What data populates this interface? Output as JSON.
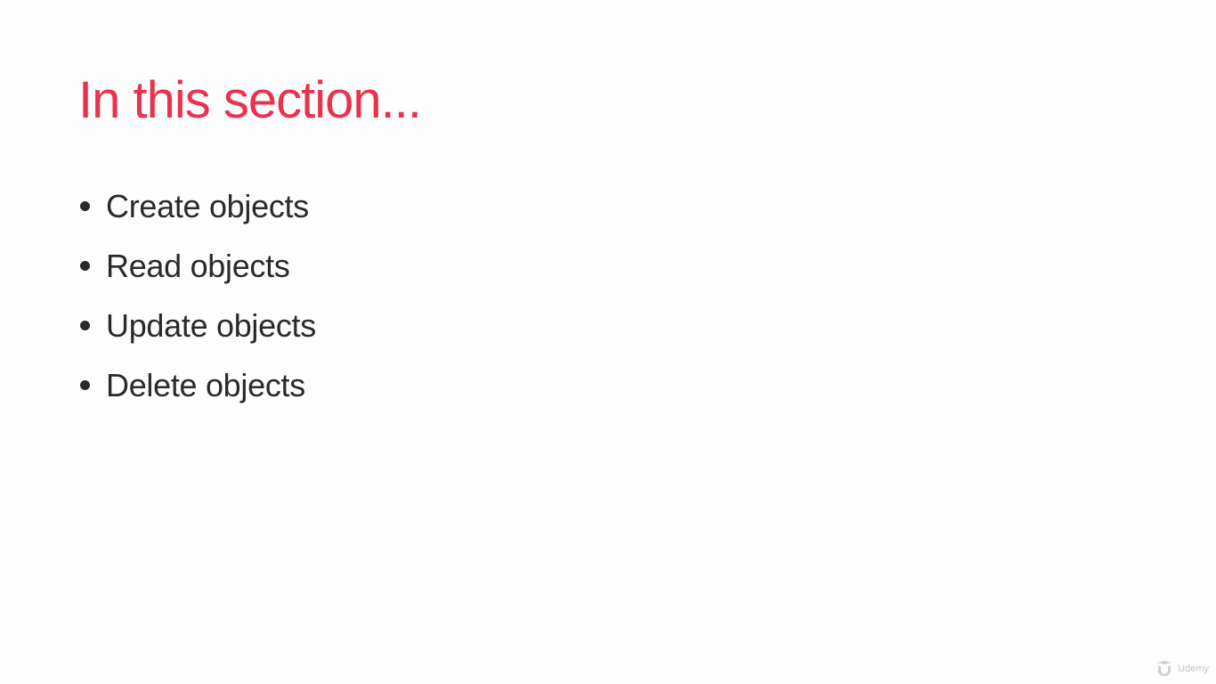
{
  "slide": {
    "title": "In this section...",
    "bullets": [
      "Create objects",
      "Read objects",
      "Update objects",
      "Delete objects"
    ]
  },
  "watermark": {
    "text": "Udemy",
    "icon": "udemy-logo-icon"
  },
  "colors": {
    "background": "#fdfdfd",
    "title": "#e8334f",
    "text": "#2a2a2a"
  }
}
